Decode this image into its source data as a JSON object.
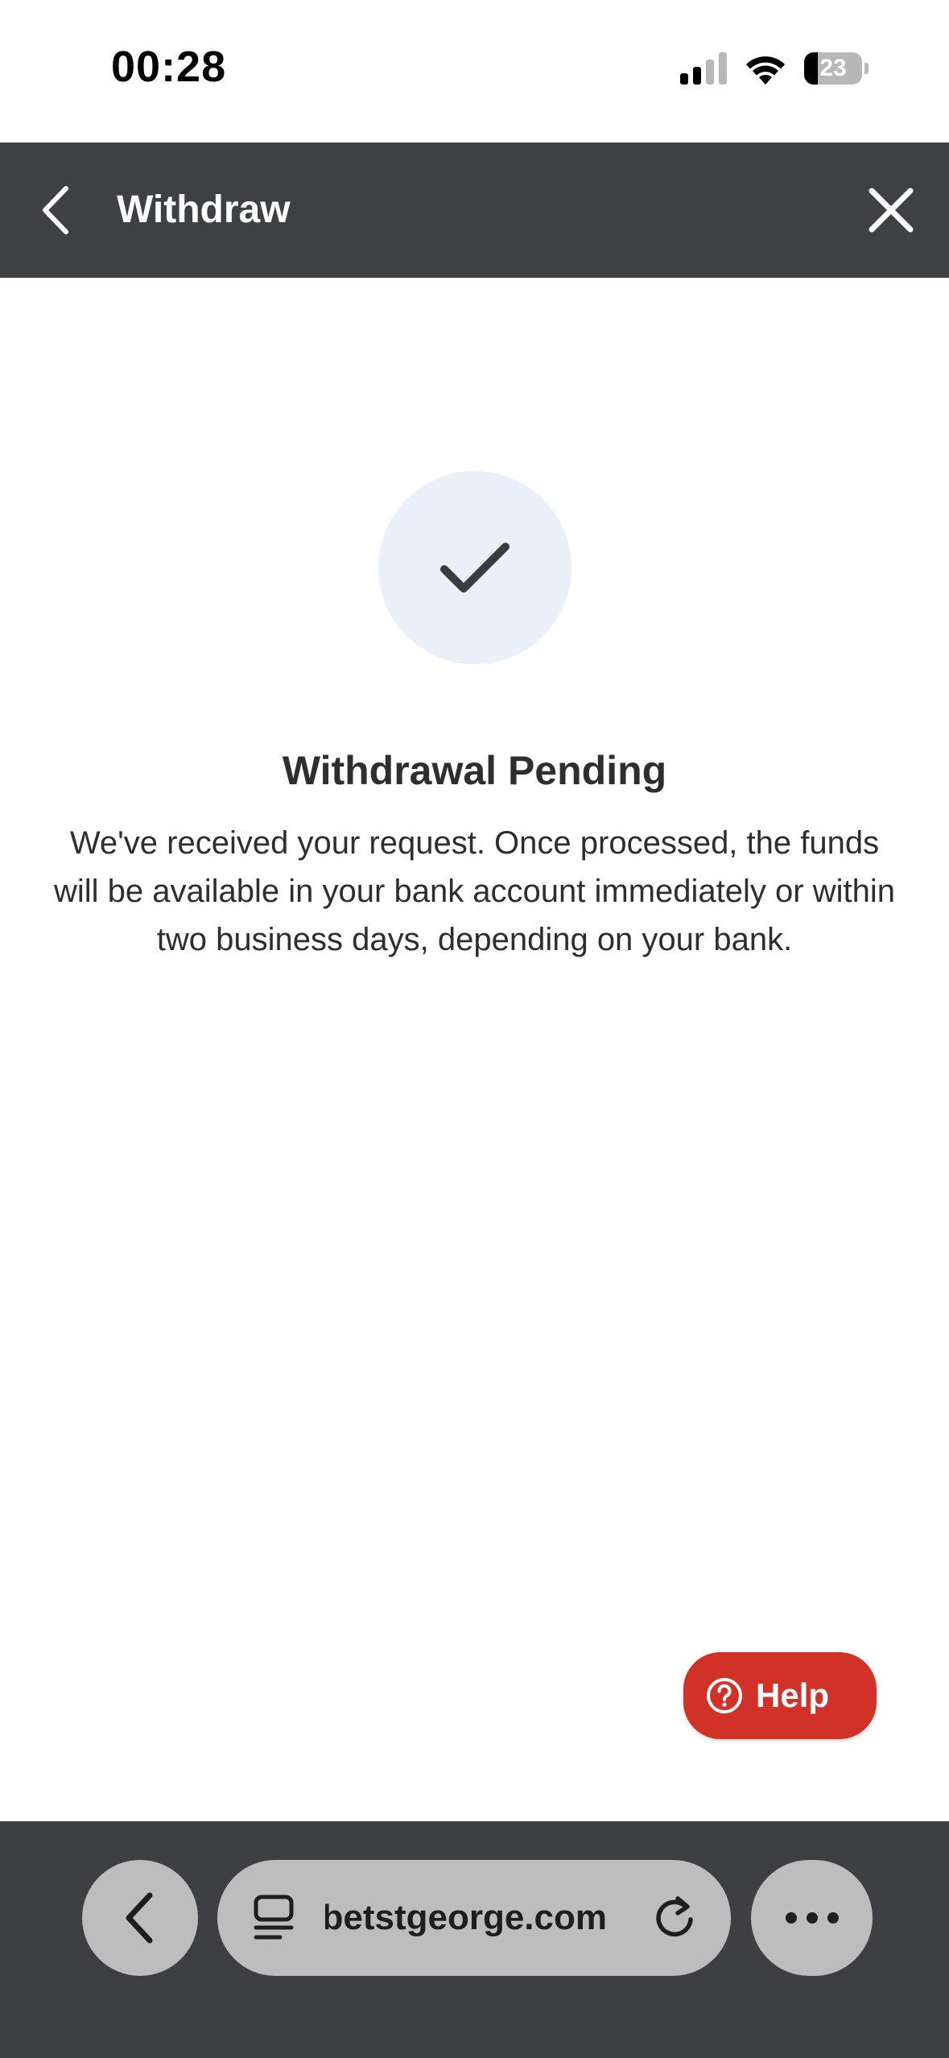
{
  "status_bar": {
    "time": "00:28",
    "battery_level": "23",
    "battery_fraction": 0.23,
    "icons": [
      "cellular-signal-icon",
      "wifi-icon",
      "battery-icon"
    ]
  },
  "header": {
    "title": "Withdraw",
    "back_icon": "chevron-left-icon",
    "close_icon": "close-icon",
    "background": "#3f4043"
  },
  "main": {
    "success_icon": "checkmark-icon",
    "title": "Withdrawal Pending",
    "message": "We've received your request. Once processed, the funds will be available in your bank account immediately or within two business days, depending on your bank."
  },
  "help": {
    "label": "Help",
    "icon": "question-circle-icon",
    "color": "#d23128"
  },
  "browser_bar": {
    "url": "betstgeorge.com",
    "back_icon": "chevron-left-icon",
    "tabs_icon": "tabs-icon",
    "reload_icon": "reload-icon",
    "more_icon": "ellipsis-icon"
  }
}
